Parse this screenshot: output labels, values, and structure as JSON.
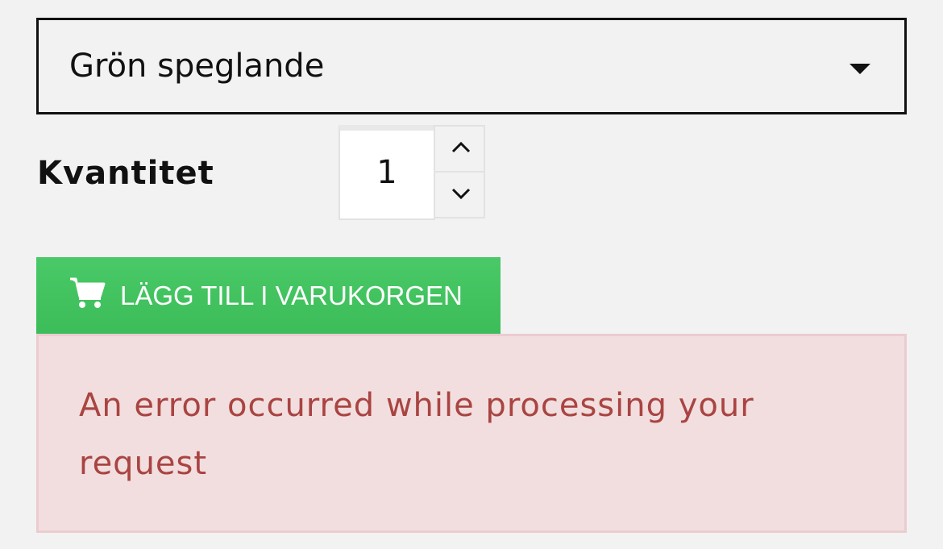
{
  "variant_select": {
    "selected": "Grön speglande"
  },
  "quantity": {
    "label": "Kvantitet",
    "value": "1"
  },
  "add_to_cart": {
    "label": "LÄGG TILL I VARUKORGEN",
    "color": "#3fbf5c"
  },
  "error_alert": {
    "message": "An error occurred while processing your request",
    "text_color": "#a94442",
    "background": "#f2dede"
  },
  "icons": {
    "cart": "cart-icon",
    "caret": "caret-down-icon",
    "up": "chevron-up-icon",
    "down": "chevron-down-icon"
  }
}
